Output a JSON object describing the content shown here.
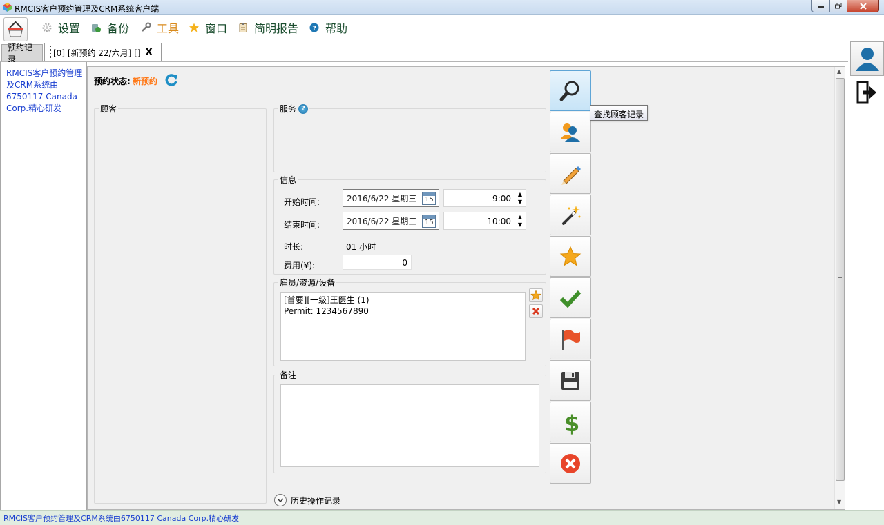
{
  "window": {
    "title": "RMCIS客户预约管理及CRM系统客户端"
  },
  "menu": {
    "items": [
      {
        "label": "设置",
        "icon": "gear-icon"
      },
      {
        "label": "备份",
        "icon": "backup-icon"
      },
      {
        "label": "工具",
        "icon": "wrench-icon"
      },
      {
        "label": "窗口",
        "icon": "star-icon"
      },
      {
        "label": "简明报告",
        "icon": "clipboard-icon"
      },
      {
        "label": "帮助",
        "icon": "help-icon"
      }
    ]
  },
  "tabs": {
    "records": "预约记录",
    "current": "[0] [新预约 22/六月] []",
    "close": "X"
  },
  "sidebar": {
    "credit": "RMCIS客户预约管理及CRM系统由6750117 Canada Corp.精心研发"
  },
  "appointment": {
    "status_label": "预约状态:",
    "status_value": "新预约",
    "customer_legend": "顾客",
    "service_legend": "服务",
    "info_legend": "信息",
    "start_label": "开始时间:",
    "start_date": "2016/6/22 星期三",
    "start_time": "9:00",
    "end_label": "结束时间:",
    "end_date": "2016/6/22 星期三",
    "end_time": "10:00",
    "duration_label": "时长:",
    "duration_value": "01 小时",
    "fee_label": "费用(¥):",
    "fee_value": "0",
    "calendar_day": "15",
    "staff_legend": "雇员/资源/设备",
    "staff_lines": [
      "[首要][一级]王医生 (1)",
      "Permit: 1234567890"
    ],
    "notes_legend": "备注",
    "history_label": "历史操作记录"
  },
  "actions": {
    "buttons": [
      {
        "name": "find-customer-button",
        "icon": "magnifier-icon"
      },
      {
        "name": "customer-button",
        "icon": "person-icon"
      },
      {
        "name": "edit-button",
        "icon": "pencil-icon"
      },
      {
        "name": "magic-button",
        "icon": "magic-wand-icon"
      },
      {
        "name": "favorite-button",
        "icon": "star-icon"
      },
      {
        "name": "confirm-button",
        "icon": "checkmark-icon"
      },
      {
        "name": "flag-button",
        "icon": "flag-icon"
      },
      {
        "name": "save-button",
        "icon": "floppy-disk-icon"
      },
      {
        "name": "payment-button",
        "icon": "dollar-icon"
      },
      {
        "name": "cancel-button",
        "icon": "close-circle-icon"
      }
    ],
    "tooltip": "查找顾客记录"
  },
  "statusbar": {
    "text": "RMCIS客户预约管理及CRM系统由6750117 Canada Corp.精心研发"
  },
  "colors": {
    "status_orange": "#ff7a1a",
    "link_blue": "#1a3fd0",
    "tools_orange": "#d98a1b",
    "menu_green": "#1a4d2e"
  }
}
